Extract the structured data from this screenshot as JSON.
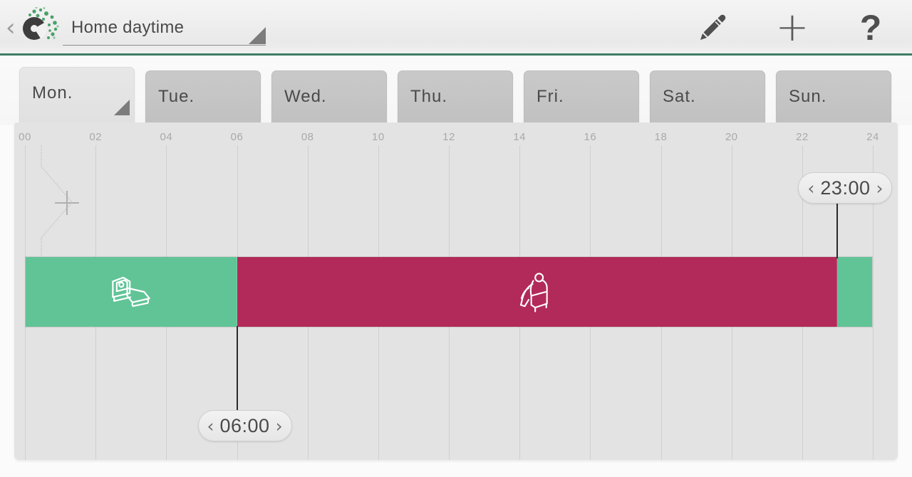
{
  "header": {
    "back_label": "‹",
    "logo_name": "app-logo",
    "title": "Home daytime",
    "title_placeholder": "Program name",
    "edit_icon": "pencil-icon",
    "add_label": "+",
    "help_label": "?",
    "accent_color": "#3d7d63"
  },
  "tabs": [
    {
      "label": "Mon.",
      "active": true
    },
    {
      "label": "Tue.",
      "active": false
    },
    {
      "label": "Wed.",
      "active": false
    },
    {
      "label": "Thu.",
      "active": false
    },
    {
      "label": "Fri.",
      "active": false
    },
    {
      "label": "Sat.",
      "active": false
    },
    {
      "label": "Sun.",
      "active": false
    }
  ],
  "timeline": {
    "hour_labels": [
      "00",
      "02",
      "04",
      "06",
      "08",
      "10",
      "12",
      "14",
      "16",
      "18",
      "20",
      "22",
      "24"
    ],
    "range_start_hour": 0,
    "range_end_hour": 24,
    "add_period_label": "+"
  },
  "segments": [
    {
      "name": "night",
      "icon": "bed-icon",
      "start": "00:00",
      "end": "06:00",
      "color": "#61c496"
    },
    {
      "name": "day",
      "icon": "armchair-icon",
      "start": "06:00",
      "end": "23:00",
      "color": "#b22a59"
    },
    {
      "name": "night-late",
      "icon": "",
      "start": "23:00",
      "end": "24:00",
      "color": "#61c496"
    }
  ],
  "handles": [
    {
      "name": "handle-0600",
      "time": "06:00",
      "prev_label": "‹",
      "next_label": "›",
      "hour": 6,
      "position": "below"
    },
    {
      "name": "handle-2300",
      "time": "23:00",
      "prev_label": "‹",
      "next_label": "›",
      "hour": 23,
      "position": "above"
    }
  ],
  "colors": {
    "green": "#61c496",
    "crimson": "#b22a59",
    "panel_bg": "#e3e3e3",
    "grid": "#cfcfcf",
    "accent": "#3d7d63"
  }
}
